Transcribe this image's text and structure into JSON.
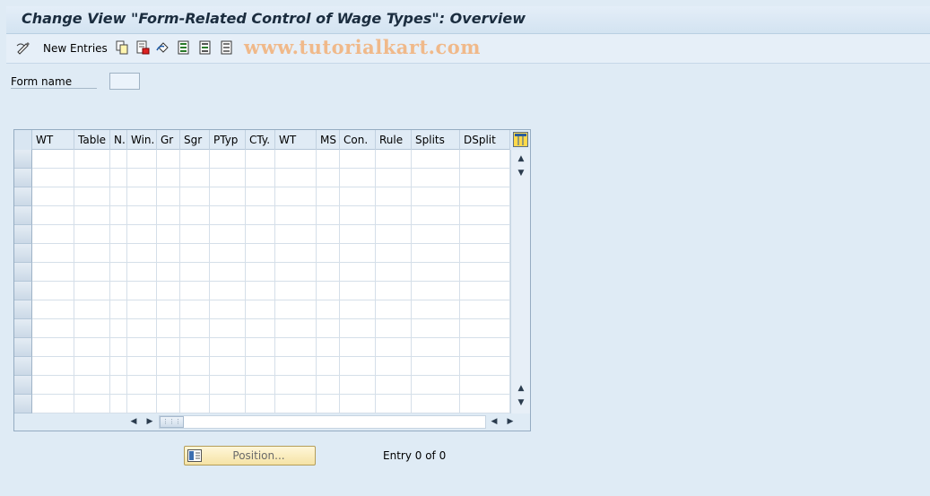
{
  "title": "Change View \"Form-Related Control of Wage Types\": Overview",
  "toolbar": {
    "new_entries_label": "New Entries",
    "watermark": "www.tutorialkart.com"
  },
  "form": {
    "form_name_label": "Form name",
    "form_name_value": ""
  },
  "table": {
    "columns": [
      "WT",
      "Table",
      "N..",
      "Win.",
      "Gr",
      "Sgr",
      "PTyp",
      "CTy.",
      "WT",
      "MS",
      "Con.",
      "Rule",
      "Splits",
      "DSplit"
    ],
    "row_count": 14
  },
  "footer": {
    "position_label": "Position...",
    "entry_info": "Entry 0 of 0"
  }
}
